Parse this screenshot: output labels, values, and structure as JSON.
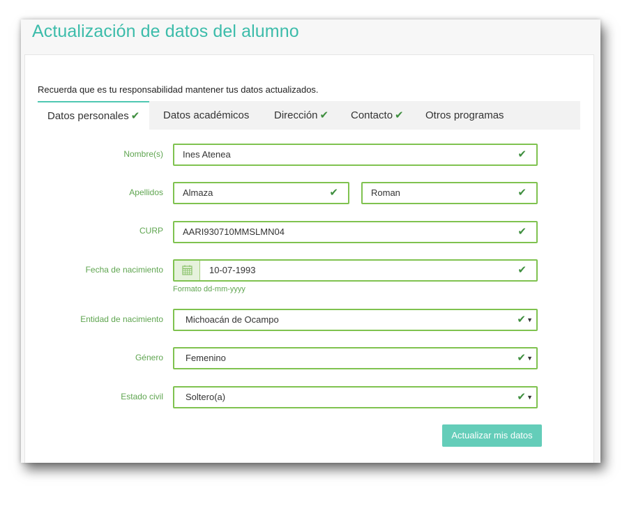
{
  "page": {
    "title": "Actualización de datos del alumno",
    "notice": "Recuerda que es tu responsabilidad mantener tus datos actualizados."
  },
  "tabs": [
    {
      "label": "Datos personales",
      "active": true,
      "checked": true
    },
    {
      "label": "Datos académicos",
      "active": false,
      "checked": false
    },
    {
      "label": "Dirección",
      "active": false,
      "checked": true
    },
    {
      "label": "Contacto",
      "active": false,
      "checked": true
    },
    {
      "label": "Otros programas",
      "active": false,
      "checked": false
    }
  ],
  "form": {
    "nombre": {
      "label": "Nombre(s)",
      "value": "Ines Atenea"
    },
    "apellidos": {
      "label": "Apellidos",
      "paterno": "Almaza",
      "materno": "Roman"
    },
    "curp": {
      "label": "CURP",
      "value": "AARI930710MMSLMN04"
    },
    "fecha": {
      "label": "Fecha de nacimiento",
      "value": "10-07-1993",
      "hint": "Formato dd-mm-yyyy"
    },
    "entidad": {
      "label": "Entidad de nacimiento",
      "value": "Michoacán de Ocampo"
    },
    "genero": {
      "label": "Género",
      "value": "Femenino"
    },
    "estado_civil": {
      "label": "Estado civil",
      "value": "Soltero(a)"
    }
  },
  "submit_label": "Actualizar mis datos",
  "icons": {
    "check": "✔",
    "caret": "▼",
    "calendar": "calendar-icon"
  },
  "colors": {
    "title": "#3cbcaa",
    "valid_border": "#7fc24f",
    "check": "#3e8e3e",
    "button": "#64cdb9",
    "tab_active_border": "#4fc7b2"
  }
}
